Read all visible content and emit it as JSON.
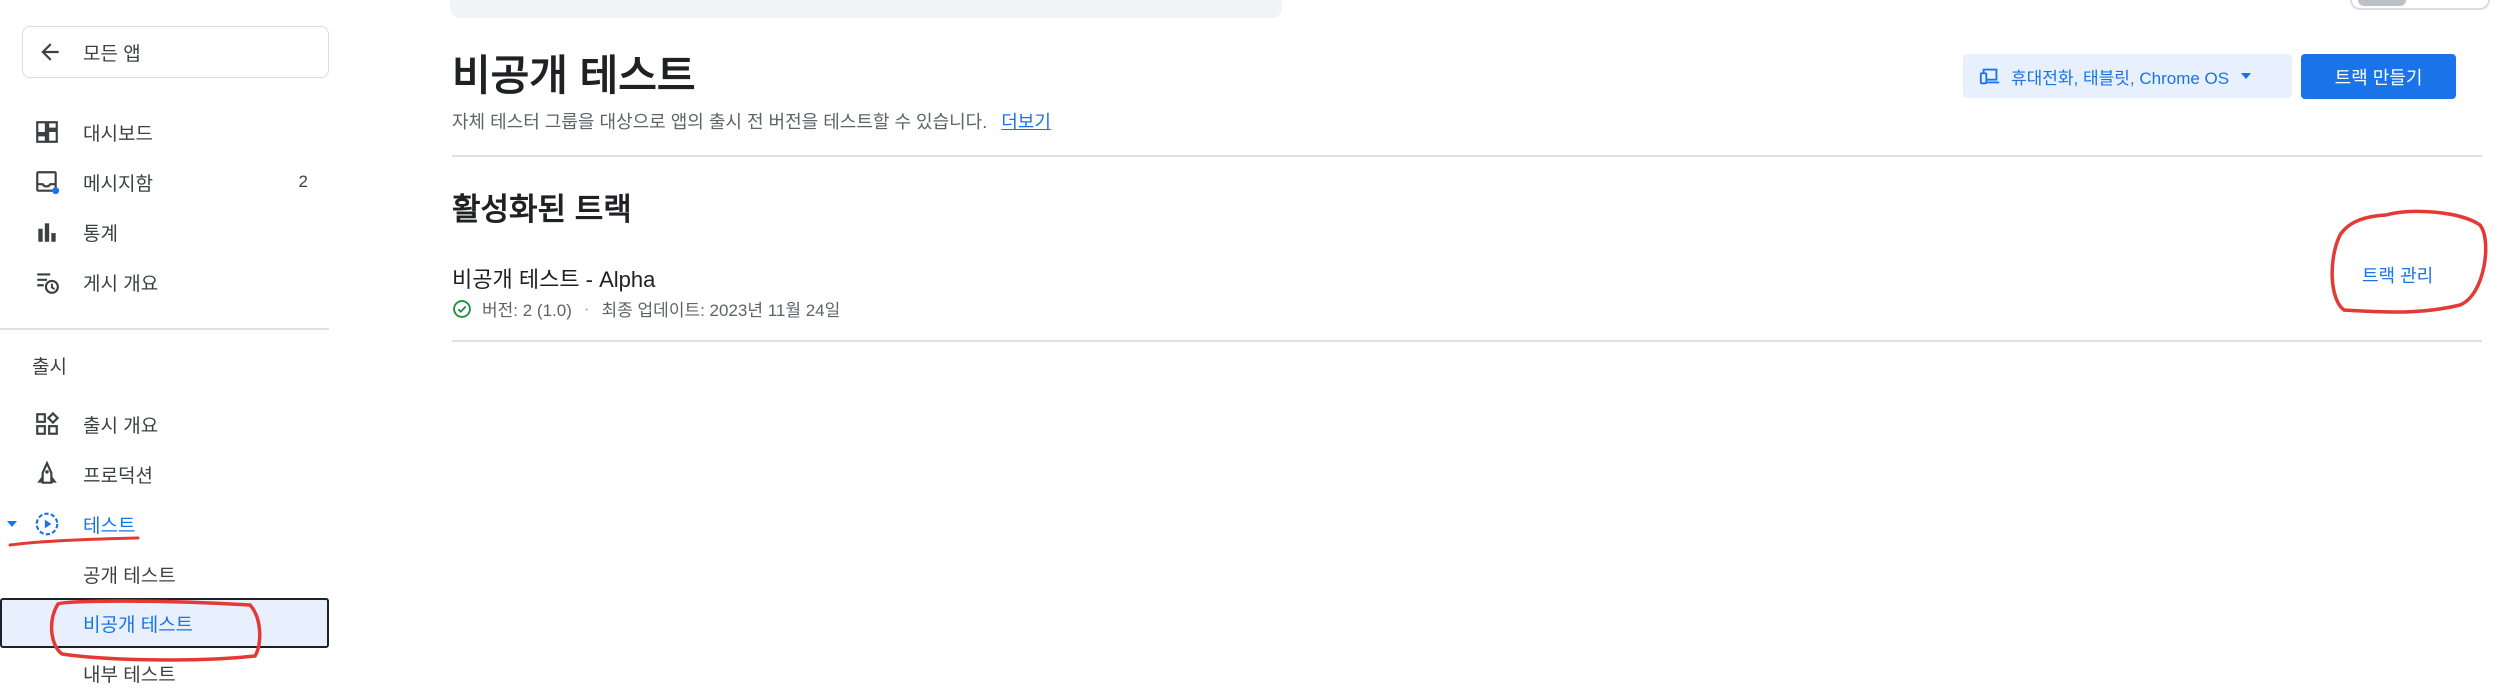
{
  "sidebar": {
    "back_label": "모든 앱",
    "items": [
      {
        "label": "대시보드",
        "icon": "dashboard-icon"
      },
      {
        "label": "메시지함",
        "icon": "inbox-icon",
        "count": "2"
      },
      {
        "label": "통계",
        "icon": "bar-chart-icon"
      },
      {
        "label": "게시 개요",
        "icon": "publish-overview-icon"
      }
    ],
    "release_section": "출시",
    "release_items": [
      {
        "label": "출시 개요",
        "icon": "grid-overview-icon"
      },
      {
        "label": "프로덕션",
        "icon": "rocket-icon"
      },
      {
        "label": "테스트",
        "icon": "play-circle-icon"
      }
    ],
    "test_sub_items": [
      {
        "label": "공개 테스트"
      },
      {
        "label": "비공개 테스트"
      },
      {
        "label": "내부 테스트"
      }
    ]
  },
  "header": {
    "title": "비공개 테스트",
    "description": "자체 테스터 그룹을 대상으로 앱의 출시 전 버전을 테스트할 수 있습니다.",
    "learn_more": "더보기",
    "device_select": "휴대전화, 태블릿, Chrome OS",
    "create_track": "트랙 만들기"
  },
  "active_tracks": {
    "title": "활성화된 트랙",
    "tracks": [
      {
        "name": "비공개 테스트 - Alpha",
        "version": "버전: 2 (1.0)",
        "updated": "최종 업데이트: 2023년 11월 24일",
        "manage": "트랙 관리"
      }
    ]
  },
  "colors": {
    "accent": "#1a73e8",
    "selected_bg": "#e8f0fe",
    "annotation": "#e53935",
    "status_ok": "#1e8e3e"
  }
}
